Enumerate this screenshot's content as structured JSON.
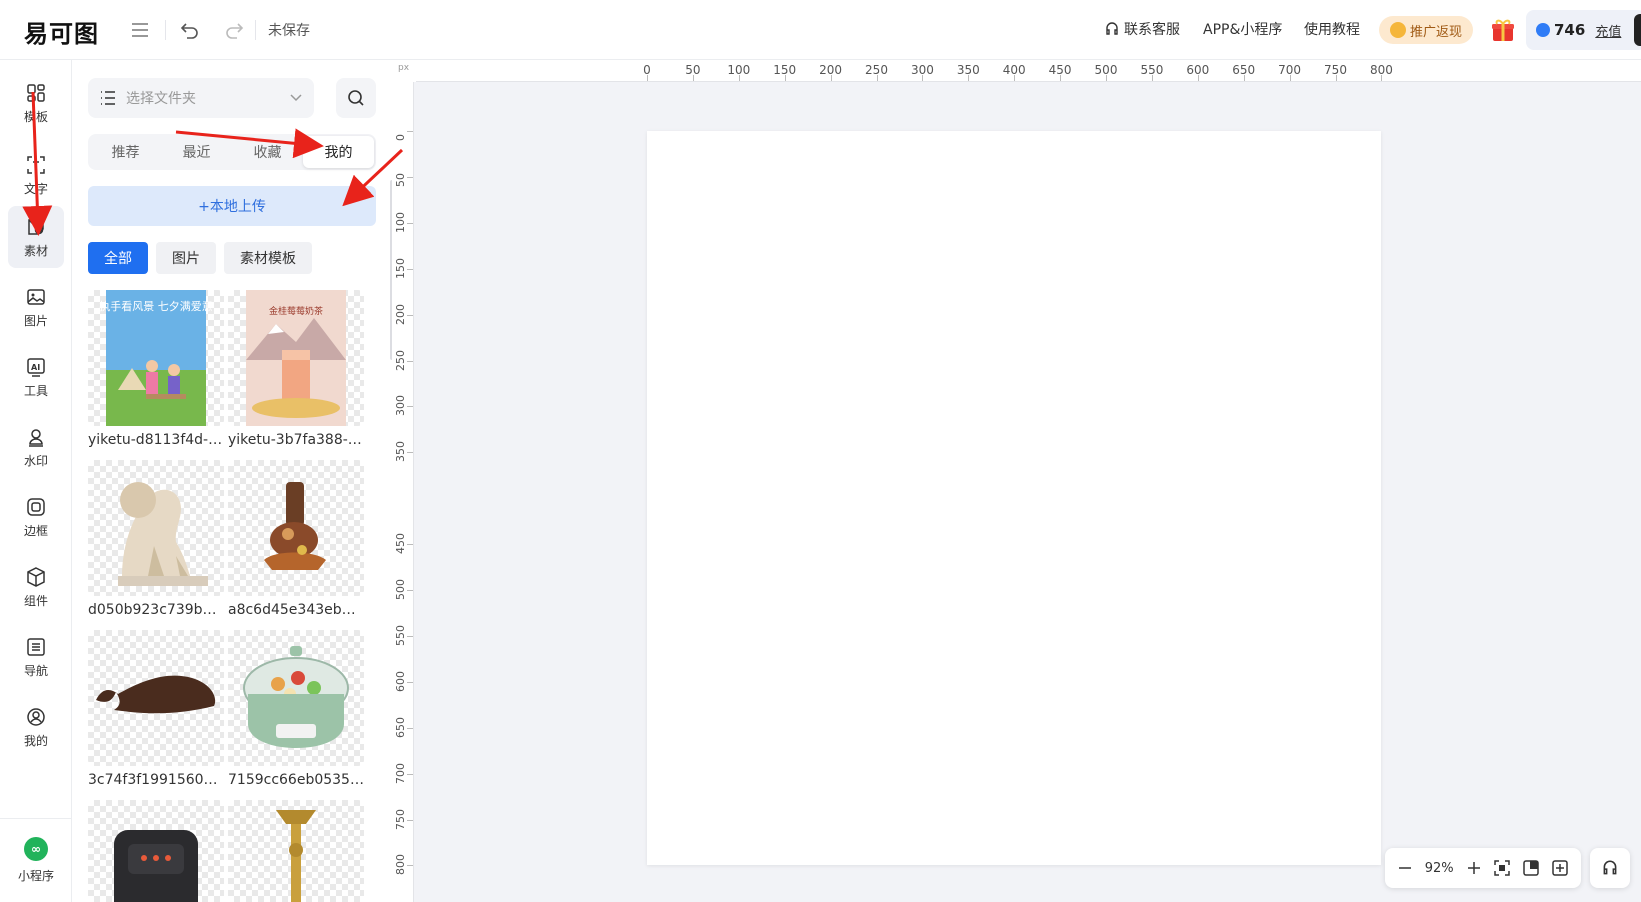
{
  "header": {
    "logo_text": "易可图",
    "save_status": "未保存",
    "links": {
      "support": "联系客服",
      "app": "APP&小程序",
      "tutorial": "使用教程"
    },
    "promo_label": "推广返现",
    "credits_value": "746",
    "recharge_label": "充值"
  },
  "sidebar": {
    "items": [
      {
        "label": "模板",
        "icon": "template-icon"
      },
      {
        "label": "文字",
        "icon": "text-icon"
      },
      {
        "label": "素材",
        "icon": "material-icon",
        "active": true
      },
      {
        "label": "图片",
        "icon": "image-icon"
      },
      {
        "label": "工具",
        "icon": "ai-tool-icon"
      },
      {
        "label": "水印",
        "icon": "watermark-icon"
      },
      {
        "label": "边框",
        "icon": "frame-icon"
      },
      {
        "label": "组件",
        "icon": "component-icon"
      },
      {
        "label": "导航",
        "icon": "navigation-icon"
      },
      {
        "label": "我的",
        "icon": "user-icon"
      }
    ],
    "bottom_label": "小程序"
  },
  "panel": {
    "folder_placeholder": "选择文件夹",
    "tabs": [
      "推荐",
      "最近",
      "收藏",
      "我的"
    ],
    "active_tab": "我的",
    "upload_label": "+本地上传",
    "filters": [
      "全部",
      "图片",
      "素材模板"
    ],
    "active_filter": "全部",
    "assets": [
      {
        "label": "yiketu-d8113f4d-e...",
        "kind": "poster-couple"
      },
      {
        "label": "yiketu-3b7fa388-e...",
        "kind": "poster-tea",
        "poster_title": "金桂莓莓奶茶"
      },
      {
        "label": "d050b923c739b14...",
        "kind": "lion-statue"
      },
      {
        "label": "a8c6d45e343eb52...",
        "kind": "decor-object"
      },
      {
        "label": "3c74f3f19915601b...",
        "kind": "whale-figure"
      },
      {
        "label": "7159cc66eb0535d...",
        "kind": "hotpot"
      },
      {
        "label": "",
        "kind": "air-fryer"
      },
      {
        "label": "",
        "kind": "candle-holder"
      }
    ],
    "poster_headline": "执手看风景 七夕满爱意"
  },
  "ruler": {
    "unit": "px",
    "top_labels": [
      "0",
      "50",
      "100",
      "150",
      "200",
      "250",
      "300",
      "350",
      "400",
      "450",
      "500",
      "550",
      "600",
      "650",
      "700",
      "750",
      "800"
    ],
    "left_labels": [
      "0",
      "50",
      "100",
      "150",
      "200",
      "250",
      "300",
      "350",
      "450",
      "500",
      "550",
      "600",
      "650",
      "700",
      "750",
      "800"
    ]
  },
  "zoom": {
    "level": "92%"
  },
  "colors": {
    "primary": "#1f6ff0",
    "upload_bg": "#dde9fb",
    "canvas_bg": "#f2f3f7",
    "annotation": "#e8231b"
  }
}
